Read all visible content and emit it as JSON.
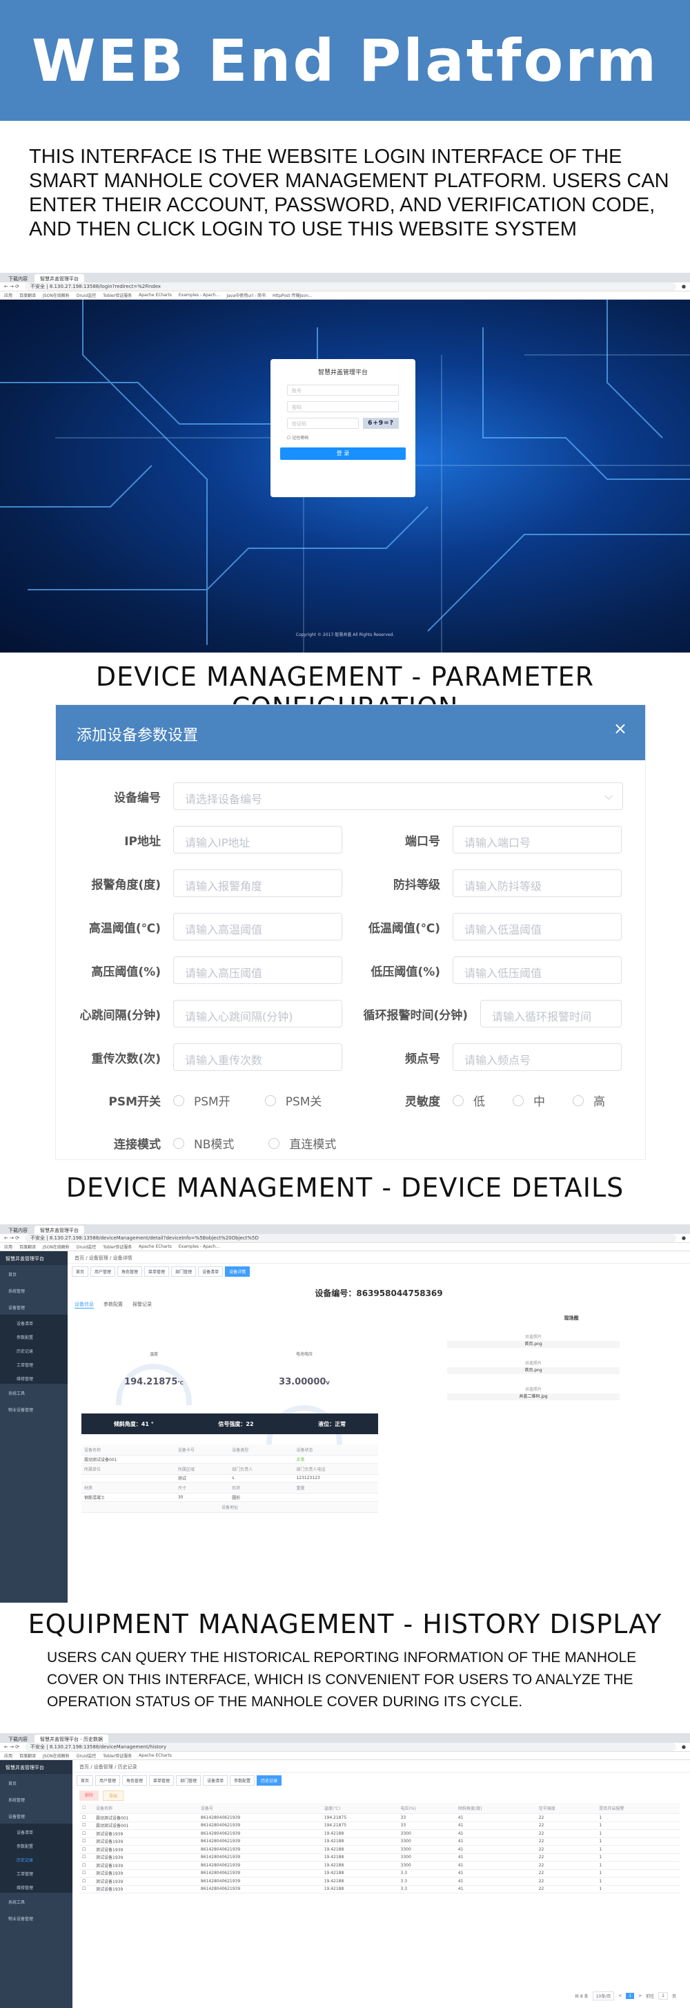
{
  "banner": {
    "title": "WEB End Platform"
  },
  "login_desc": "THIS INTERFACE IS THE WEBSITE LOGIN INTERFACE OF THE SMART MANHOLE COVER MANAGEMENT PLATFORM. USERS CAN ENTER THEIR ACCOUNT, PASSWORD, AND VERIFICATION CODE, AND THEN CLICK LOGIN TO USE THIS WEBSITE SYSTEM",
  "browser1": {
    "tab1": "下载内容",
    "tab2": "智慧井盖管理平台",
    "url": "8.130.27.198:13588/login?redirect=%2Findex",
    "insecure": "不安全"
  },
  "bookmarks": [
    "应用",
    "百度翻译",
    "JSON在线解析",
    "Druid监控",
    "Tobler验证服务",
    "Apache ECharts",
    "Examples - Apach...",
    "Java中使用url - 简书",
    "HttpPost 传输Json..."
  ],
  "login": {
    "title": "智慧井盖管理平台",
    "account": "账号",
    "password": "密码",
    "captcha": "验证码",
    "captcha_img": "6+9=?",
    "remember": "记住密码",
    "login_btn": "登 录",
    "copyright": "Copyright © 2017-智慧井盖 All Rights Reserved."
  },
  "sec_param": "DEVICE MANAGEMENT - PARAMETER CONFIGURATION",
  "param": {
    "title": "添加设备参数设置",
    "close": "×",
    "device_no_label": "设备编号",
    "device_no_ph": "请选择设备编号",
    "ip_label": "IP地址",
    "ip_ph": "请输入IP地址",
    "port_label": "端口号",
    "port_ph": "请输入端口号",
    "alarm_angle_label": "报警角度(度)",
    "alarm_angle_ph": "请输入报警角度",
    "shake_label": "防抖等级",
    "shake_ph": "请输入防抖等级",
    "high_temp_label": "高温阈值(℃)",
    "high_temp_ph": "请输入高温阈值",
    "low_temp_label": "低温阈值(℃)",
    "low_temp_ph": "请输入低温阈值",
    "high_press_label": "高压阈值(%)",
    "high_press_ph": "请输入高压阈值",
    "low_press_label": "低压阈值(%)",
    "low_press_ph": "请输入低压阈值",
    "heartbeat_label": "心跳间隔(分钟)",
    "heartbeat_ph": "请输入心跳间隔(分钟)",
    "loop_label": "循环报警时间(分钟)",
    "loop_ph": "请输入循环报警时间",
    "retry_label": "重传次数(次)",
    "retry_ph": "请输入重传次数",
    "freq_label": "频点号",
    "freq_ph": "请输入频点号",
    "psm_label": "PSM开关",
    "psm_on": "PSM开",
    "psm_off": "PSM关",
    "sens_label": "灵敏度",
    "sens_low": "低",
    "sens_mid": "中",
    "sens_high": "高",
    "conn_label": "连接模式",
    "conn_nb": "NB模式",
    "conn_direct": "直连模式"
  },
  "sec_details": "DEVICE MANAGEMENT - DEVICE DETAILS",
  "browser2": {
    "url": "8.130.27.198:13588/deviceManagement/detail?deviceInfo=%5Bobject%20Object%5D"
  },
  "app": {
    "logo": "智慧井盖管理平台",
    "menu_home": "首页",
    "menu_sys": "系统管理",
    "menu_dev": "设备管理",
    "sub_list": "设备清单",
    "sub_param": "参数配置",
    "sub_history": "历史记录",
    "sub_work": "工单管理",
    "sub_maint": "维修管理",
    "menu_tools": "系统工具",
    "menu_plat": "物业设备管理"
  },
  "details": {
    "crumb": "首页 / 设备管理 / 设备详情",
    "tags": [
      "首页",
      "用户管理",
      "角色管理",
      "菜单管理",
      "部门管理",
      "设备清单",
      "设备详情"
    ],
    "device_no": "设备编号：863958044758369",
    "tab1": "设备信息",
    "tab2": "参数配置",
    "tab3": "报警记录",
    "g1_label": "温度",
    "g1_val": "194.21875",
    "g1_unit": "℃",
    "g2_label": "电池电压",
    "g2_val": "33.00000",
    "g2_unit": "V",
    "tilt": "倾斜角度：41 °",
    "signal": "信号强度：22",
    "water": "液位：正常",
    "scene": "现场图",
    "img1_lbl": "井盖照片",
    "img1": "首页.png",
    "img2_lbl": "井盖照片",
    "img2": "首页.png",
    "img3_lbl": "井盖照片",
    "img3": "井盖二维码.jpg",
    "r1": [
      "设备名称",
      "设备卡号",
      "设备类型",
      "设备状态"
    ],
    "r2": [
      "震动测试设备001",
      "",
      "",
      "正常"
    ],
    "r3": [
      "所属单位",
      "所属区域",
      "部门负责人",
      "部门负责人电话"
    ],
    "r4": [
      "",
      "测试",
      "s",
      "123123123"
    ],
    "r5": [
      "材质",
      "尺寸",
      "形状",
      "重量"
    ],
    "r6": [
      "钢筋混凝土",
      "30",
      "圆形",
      ""
    ],
    "addr": "设备地址"
  },
  "sec_history": "EQUIPMENT MANAGEMENT - HISTORY DISPLAY",
  "history_desc": "USERS CAN QUERY THE HISTORICAL REPORTING INFORMATION OF THE MANHOLE COVER ON THIS INTERFACE, WHICH IS CONVENIENT FOR USERS TO ANALYZE THE OPERATION STATUS OF THE MANHOLE COVER DURING ITS CYCLE.",
  "browser3": {
    "tab2": "智慧井盖管理平台 - 历史数据",
    "url": "8.130.27.198:13588/deviceManagement/history"
  },
  "history": {
    "crumb": "首页 / 设备管理 / 历史记录",
    "tags": [
      "首页",
      "用户管理",
      "角色管理",
      "菜单管理",
      "部门管理",
      "设备清单",
      "参数配置",
      "历史记录"
    ],
    "btn_del": "删除",
    "btn_export": "导出",
    "headers": [
      "设备名称",
      "设备号",
      "温度(℃)",
      "电压(%)",
      "倾斜角度(度)",
      "信号强度",
      "是否开启报警"
    ],
    "rows": [
      [
        "震动测试设备001",
        "861428040621939",
        "194.21875",
        "33",
        "41",
        "22",
        "1"
      ],
      [
        "震动测试设备001",
        "861428040621939",
        "194.21875",
        "33",
        "41",
        "22",
        "1"
      ],
      [
        "测试设备1939",
        "861428040621939",
        "19.42188",
        "3300",
        "41",
        "22",
        "1"
      ],
      [
        "测试设备1939",
        "861428040621939",
        "19.42188",
        "3300",
        "41",
        "22",
        "1"
      ],
      [
        "测试设备1939",
        "861428040621939",
        "19.42188",
        "3300",
        "41",
        "22",
        "1"
      ],
      [
        "测试设备1939",
        "861428040621939",
        "19.42188",
        "3300",
        "41",
        "22",
        "1"
      ],
      [
        "测试设备1939",
        "861428040621939",
        "19.42188",
        "3300",
        "41",
        "22",
        "1"
      ],
      [
        "测试设备1939",
        "861428040621939",
        "19.42188",
        "3.3",
        "41",
        "22",
        "1"
      ],
      [
        "测试设备1939",
        "861428040621939",
        "19.42188",
        "3.3",
        "41",
        "22",
        "1"
      ],
      [
        "测试设备1939",
        "861428040621939",
        "19.42188",
        "3.3",
        "41",
        "22",
        "1"
      ]
    ],
    "total": "共 8 条",
    "page_size": "10条/页",
    "prev": "<",
    "page": "1",
    "next": ">",
    "goto": "前往",
    "page_input": "1",
    "page_unit": "页"
  },
  "colors": {
    "banner": "#4a84c1",
    "primary": "#1890ff",
    "sidebar": "#304156"
  }
}
